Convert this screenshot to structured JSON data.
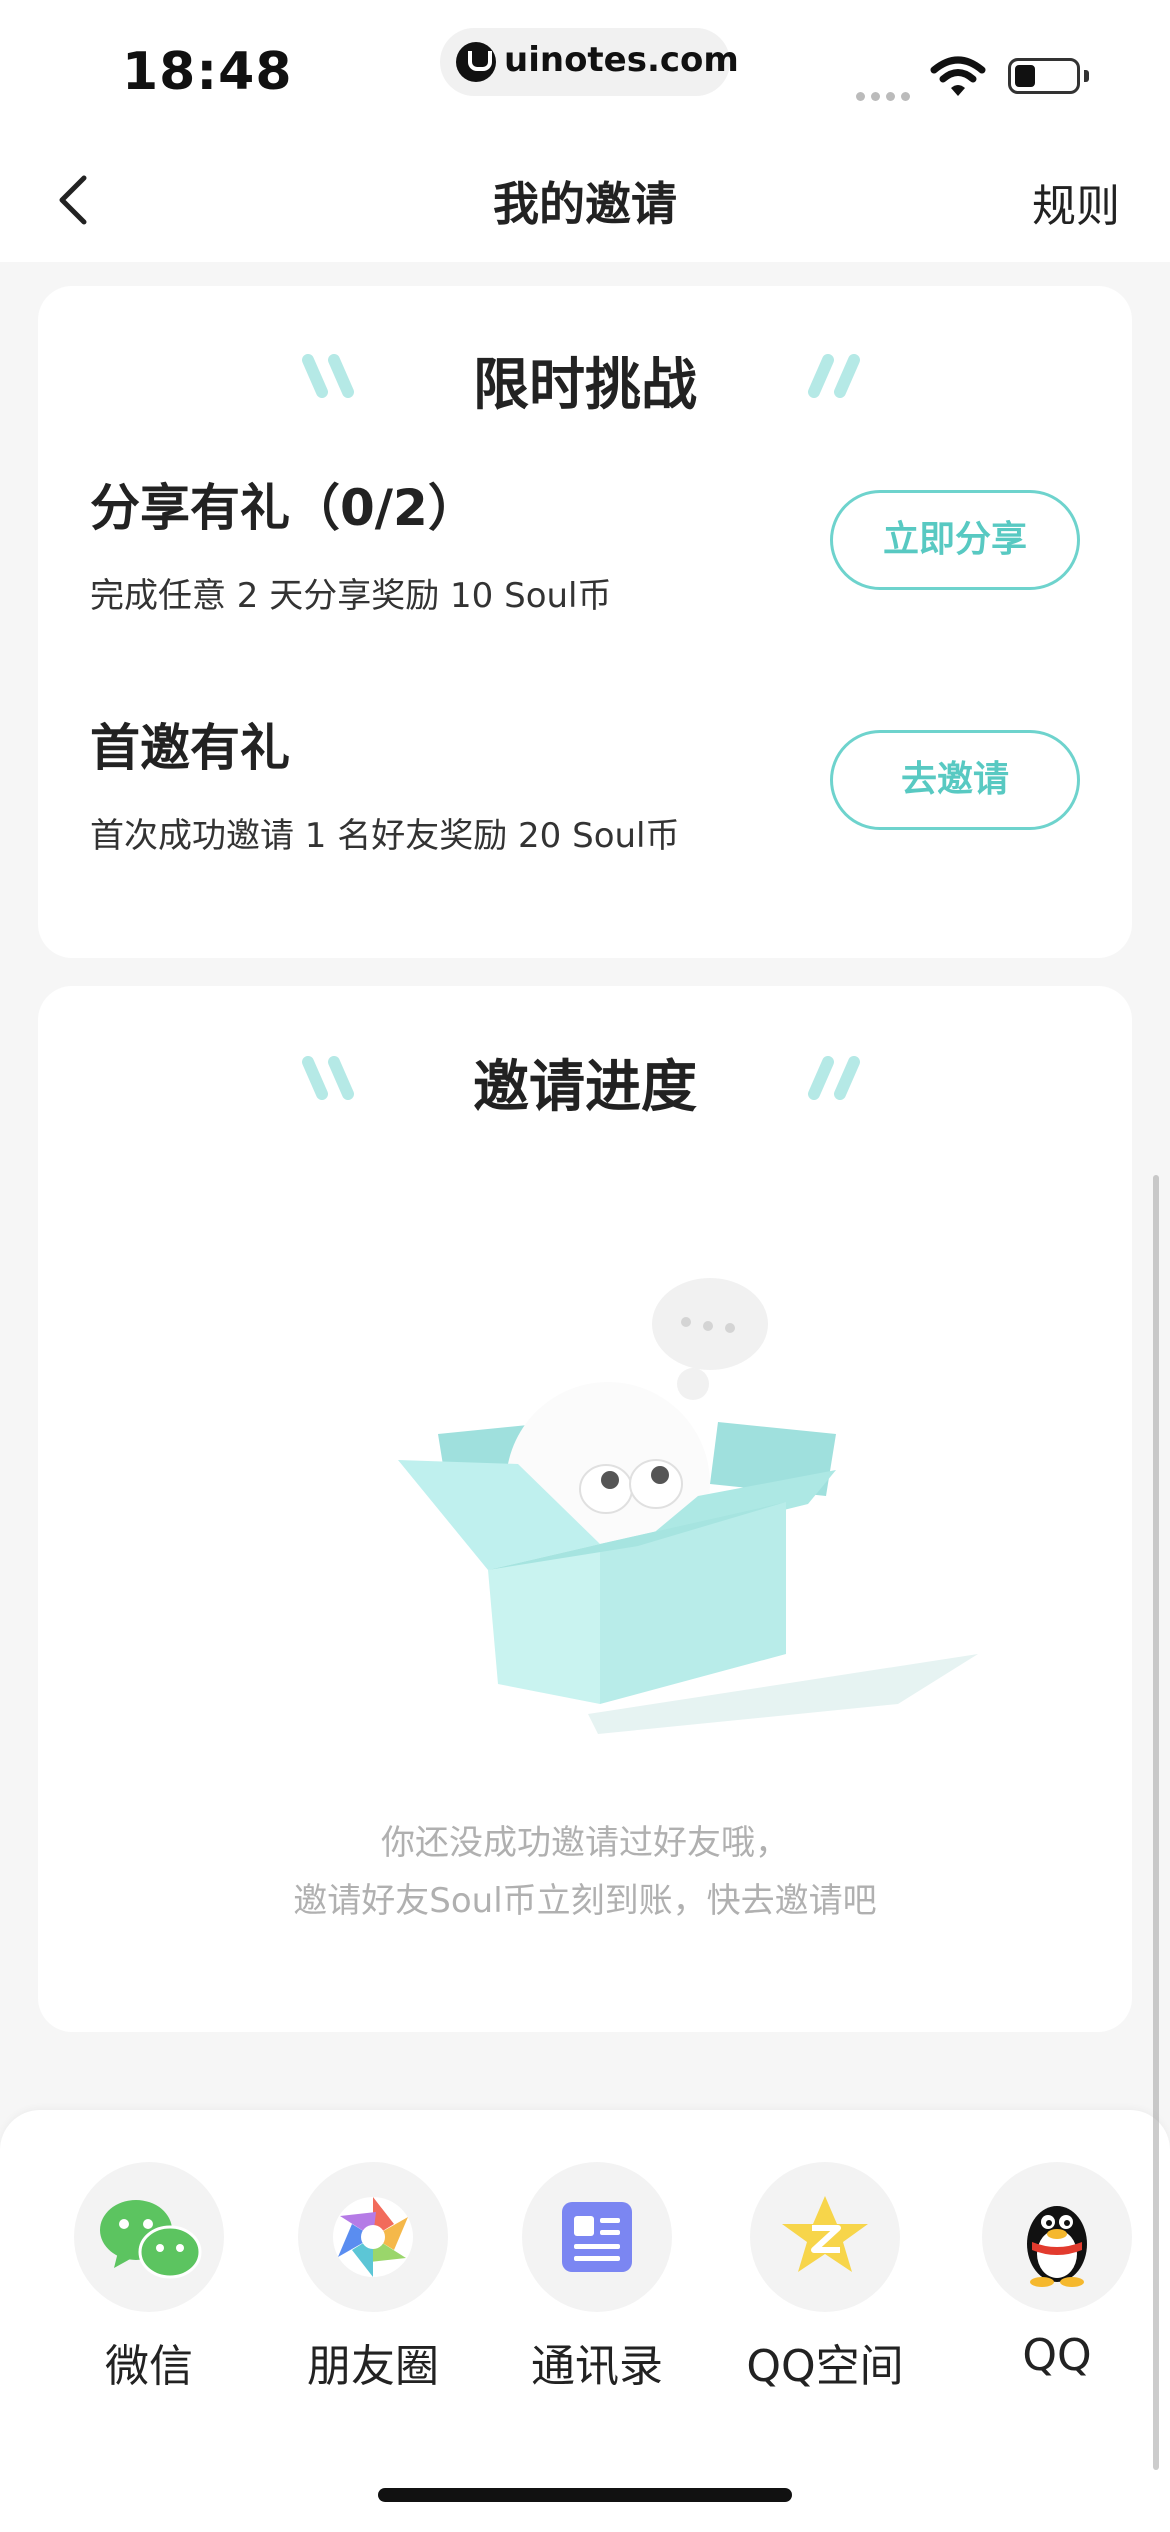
{
  "status_bar": {
    "time": "18:48",
    "url": "uinotes.com"
  },
  "nav": {
    "title": "我的邀请",
    "rules": "规则"
  },
  "challenge": {
    "title": "限时挑战",
    "tasks": [
      {
        "title": "分享有礼（0/2）",
        "desc": "完成任意 2 天分享奖励 10 Soul币",
        "button": "立即分享"
      },
      {
        "title": "首邀有礼",
        "desc": "首次成功邀请 1 名好友奖励 20 Soul币",
        "button": "去邀请"
      }
    ]
  },
  "progress": {
    "title": "邀请进度",
    "empty_line1": "你还没成功邀请过好友哦，",
    "empty_line2": "邀请好友Soul币立刻到账，快去邀请吧"
  },
  "share": {
    "items": [
      {
        "label": "微信",
        "icon": "wechat-icon"
      },
      {
        "label": "朋友圈",
        "icon": "moments-icon"
      },
      {
        "label": "通讯录",
        "icon": "contacts-icon"
      },
      {
        "label": "QQ空间",
        "icon": "qzone-icon"
      },
      {
        "label": "QQ",
        "icon": "qq-icon"
      }
    ]
  },
  "colors": {
    "accent": "#58c9c2",
    "accent_border": "#6ed3cd",
    "quote": "#b5e9e6",
    "background": "#f6f6f6"
  }
}
